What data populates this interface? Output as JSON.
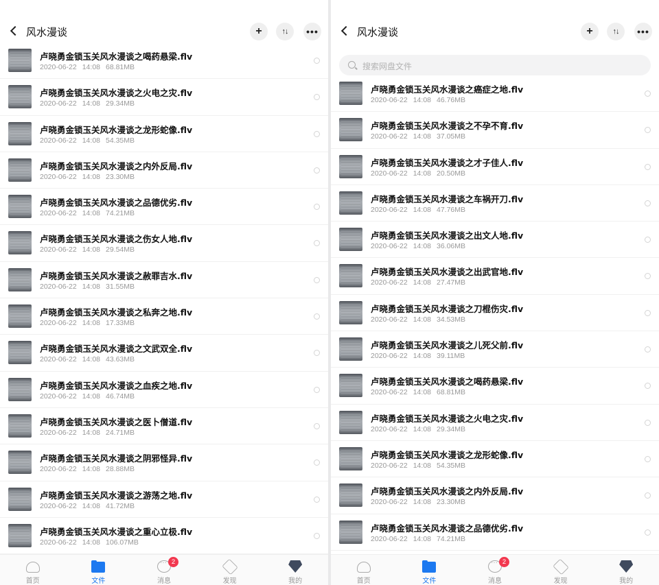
{
  "header": {
    "title": "风水漫谈",
    "plus": "+",
    "sort": "↑↓",
    "more": "•••"
  },
  "search": {
    "placeholder": "搜索网盘文件"
  },
  "tabbar": {
    "tabs": [
      {
        "label": "首页"
      },
      {
        "label": "文件",
        "active": true
      },
      {
        "label": "消息",
        "badge": "2"
      },
      {
        "label": "发现"
      },
      {
        "label": "我的"
      }
    ]
  },
  "left_files": [
    {
      "name": "卢晓勇金锁玉关风水漫谈之喝药悬梁.flv",
      "date": "2020-06-22",
      "time": "14:08",
      "size": "68.81MB"
    },
    {
      "name": "卢晓勇金锁玉关风水漫谈之火电之灾.flv",
      "date": "2020-06-22",
      "time": "14:08",
      "size": "29.34MB"
    },
    {
      "name": "卢晓勇金锁玉关风水漫谈之龙形蛇像.flv",
      "date": "2020-06-22",
      "time": "14:08",
      "size": "54.35MB"
    },
    {
      "name": "卢晓勇金锁玉关风水漫谈之内外反局.flv",
      "date": "2020-06-22",
      "time": "14:08",
      "size": "23.30MB"
    },
    {
      "name": "卢晓勇金锁玉关风水漫谈之品德优劣.flv",
      "date": "2020-06-22",
      "time": "14:08",
      "size": "74.21MB"
    },
    {
      "name": "卢晓勇金锁玉关风水漫谈之伤女人地.flv",
      "date": "2020-06-22",
      "time": "14:08",
      "size": "29.54MB"
    },
    {
      "name": "卢晓勇金锁玉关风水漫谈之赦罪吉水.flv",
      "date": "2020-06-22",
      "time": "14:08",
      "size": "31.55MB"
    },
    {
      "name": "卢晓勇金锁玉关风水漫谈之私奔之地.flv",
      "date": "2020-06-22",
      "time": "14:08",
      "size": "17.33MB"
    },
    {
      "name": "卢晓勇金锁玉关风水漫谈之文武双全.flv",
      "date": "2020-06-22",
      "time": "14:08",
      "size": "43.63MB"
    },
    {
      "name": "卢晓勇金锁玉关风水漫谈之血疾之地.flv",
      "date": "2020-06-22",
      "time": "14:08",
      "size": "46.74MB"
    },
    {
      "name": "卢晓勇金锁玉关风水漫谈之医卜僧道.flv",
      "date": "2020-06-22",
      "time": "14:08",
      "size": "24.71MB"
    },
    {
      "name": "卢晓勇金锁玉关风水漫谈之阴邪怪异.flv",
      "date": "2020-06-22",
      "time": "14:08",
      "size": "28.88MB"
    },
    {
      "name": "卢晓勇金锁玉关风水漫谈之游荡之地.flv",
      "date": "2020-06-22",
      "time": "14:08",
      "size": "41.72MB"
    },
    {
      "name": "卢晓勇金锁玉关风水漫谈之重心立极.flv",
      "date": "2020-06-22",
      "time": "14:08",
      "size": "106.07MB"
    }
  ],
  "right_files": [
    {
      "name": "卢晓勇金锁玉关风水漫谈之癌症之地.flv",
      "date": "2020-06-22",
      "time": "14:08",
      "size": "46.76MB"
    },
    {
      "name": "卢晓勇金锁玉关风水漫谈之不孕不育.flv",
      "date": "2020-06-22",
      "time": "14:08",
      "size": "37.05MB"
    },
    {
      "name": "卢晓勇金锁玉关风水漫谈之才子佳人.flv",
      "date": "2020-06-22",
      "time": "14:08",
      "size": "20.50MB"
    },
    {
      "name": "卢晓勇金锁玉关风水漫谈之车祸开刀.flv",
      "date": "2020-06-22",
      "time": "14:08",
      "size": "47.76MB"
    },
    {
      "name": "卢晓勇金锁玉关风水漫谈之出文人地.flv",
      "date": "2020-06-22",
      "time": "14:08",
      "size": "36.06MB"
    },
    {
      "name": "卢晓勇金锁玉关风水漫谈之出武官地.flv",
      "date": "2020-06-22",
      "time": "14:08",
      "size": "27.47MB"
    },
    {
      "name": "卢晓勇金锁玉关风水漫谈之刀棍伤灾.flv",
      "date": "2020-06-22",
      "time": "14:08",
      "size": "34.53MB"
    },
    {
      "name": "卢晓勇金锁玉关风水漫谈之儿死父前.flv",
      "date": "2020-06-22",
      "time": "14:08",
      "size": "39.11MB"
    },
    {
      "name": "卢晓勇金锁玉关风水漫谈之喝药悬梁.flv",
      "date": "2020-06-22",
      "time": "14:08",
      "size": "68.81MB"
    },
    {
      "name": "卢晓勇金锁玉关风水漫谈之火电之灾.flv",
      "date": "2020-06-22",
      "time": "14:08",
      "size": "29.34MB"
    },
    {
      "name": "卢晓勇金锁玉关风水漫谈之龙形蛇像.flv",
      "date": "2020-06-22",
      "time": "14:08",
      "size": "54.35MB"
    },
    {
      "name": "卢晓勇金锁玉关风水漫谈之内外反局.flv",
      "date": "2020-06-22",
      "time": "14:08",
      "size": "23.30MB"
    },
    {
      "name": "卢晓勇金锁玉关风水漫谈之品德优劣.flv",
      "date": "2020-06-22",
      "time": "14:08",
      "size": "74.21MB"
    }
  ]
}
